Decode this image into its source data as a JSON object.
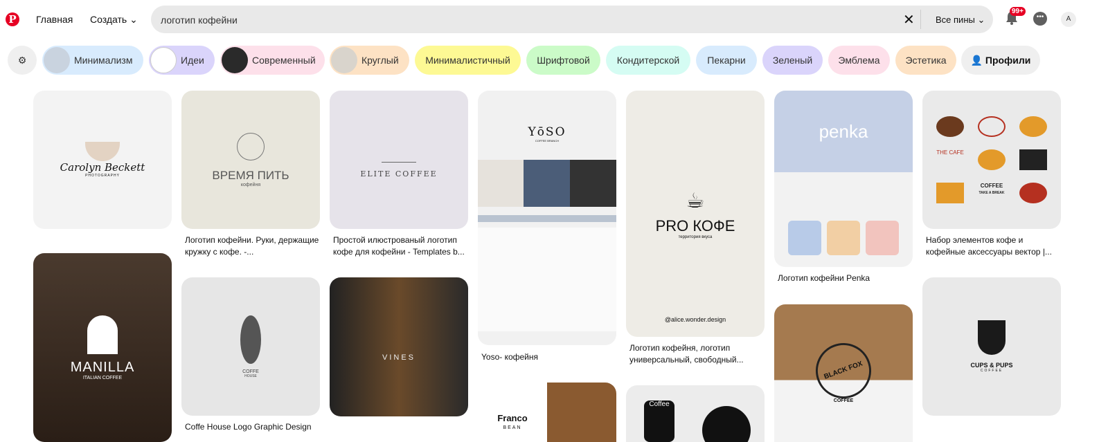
{
  "header": {
    "logo": "P",
    "home": "Главная",
    "create": "Создать",
    "search_value": "логотип кофейни",
    "clear_icon": "close-icon",
    "scope": "Все пины",
    "notifications_badge": "99+",
    "avatar_initial": "А"
  },
  "chips": [
    {
      "label": "Минимализм",
      "color": "#d8ebfd"
    },
    {
      "label": "Идеи",
      "color": "#dad4fb"
    },
    {
      "label": "Современный",
      "color": "#fde0ea"
    },
    {
      "label": "Круглый",
      "color": "#fde2c4"
    },
    {
      "label": "Минималистичный",
      "color": "#fdf994"
    },
    {
      "label": "Шрифтовой",
      "color": "#cbfbc8"
    },
    {
      "label": "Кондитерской",
      "color": "#d5fcf3"
    },
    {
      "label": "Пекарни",
      "color": "#d8ebfd"
    },
    {
      "label": "Зеленый",
      "color": "#dad4fb"
    },
    {
      "label": "Эмблема",
      "color": "#fde0ea"
    },
    {
      "label": "Эстетика",
      "color": "#fde2c4"
    },
    {
      "label": "Профили",
      "color": "#efefef"
    }
  ],
  "pins": [
    {
      "logo": "Carolyn Beckett",
      "sub": "PHOTOGRAPHY"
    },
    {
      "logo": "MANILLA",
      "sub": "ITALIAN COFFEE"
    },
    {
      "logo": "ВРЕМЯ ПИТЬ",
      "sub": "кофейня",
      "caption": "Логотип кофейни. Руки, держащие кружку с кофе. -..."
    },
    {
      "logo": "COFFE",
      "sub": "HOUSE",
      "caption": "Coffe House Logo Graphic Design"
    },
    {
      "logo": "ELITE COFFEE",
      "caption": "Простой илюстрованый логотип кофе для кофейни - Templates b..."
    },
    {
      "logo": "VINES"
    },
    {
      "logo": "YōSO",
      "sub": "COFFEE BRANCH",
      "caption": "Yoso- кофейня"
    },
    {
      "logo": "Franco",
      "sub": "BEAN"
    },
    {
      "logo": "PRO КОФЕ",
      "sub": "территория вкуса",
      "credit": "@alice.wonder.design",
      "caption": "Логотип кофейня, логотип универсальный, свободный..."
    },
    {
      "logo": "Coffee"
    },
    {
      "logo": "penka",
      "caption": "Логотип кофейни Penka"
    },
    {
      "logo": "BLACK FOX",
      "sub": "COFFEE"
    },
    {
      "logo": "COFFEE",
      "sub": "TAKE A BREAK",
      "caption": "Набор элементов кофе и кофейные аксессуары вектор |..."
    },
    {
      "logo": "CUPS & PUPS",
      "sub": "COFFEE"
    }
  ]
}
